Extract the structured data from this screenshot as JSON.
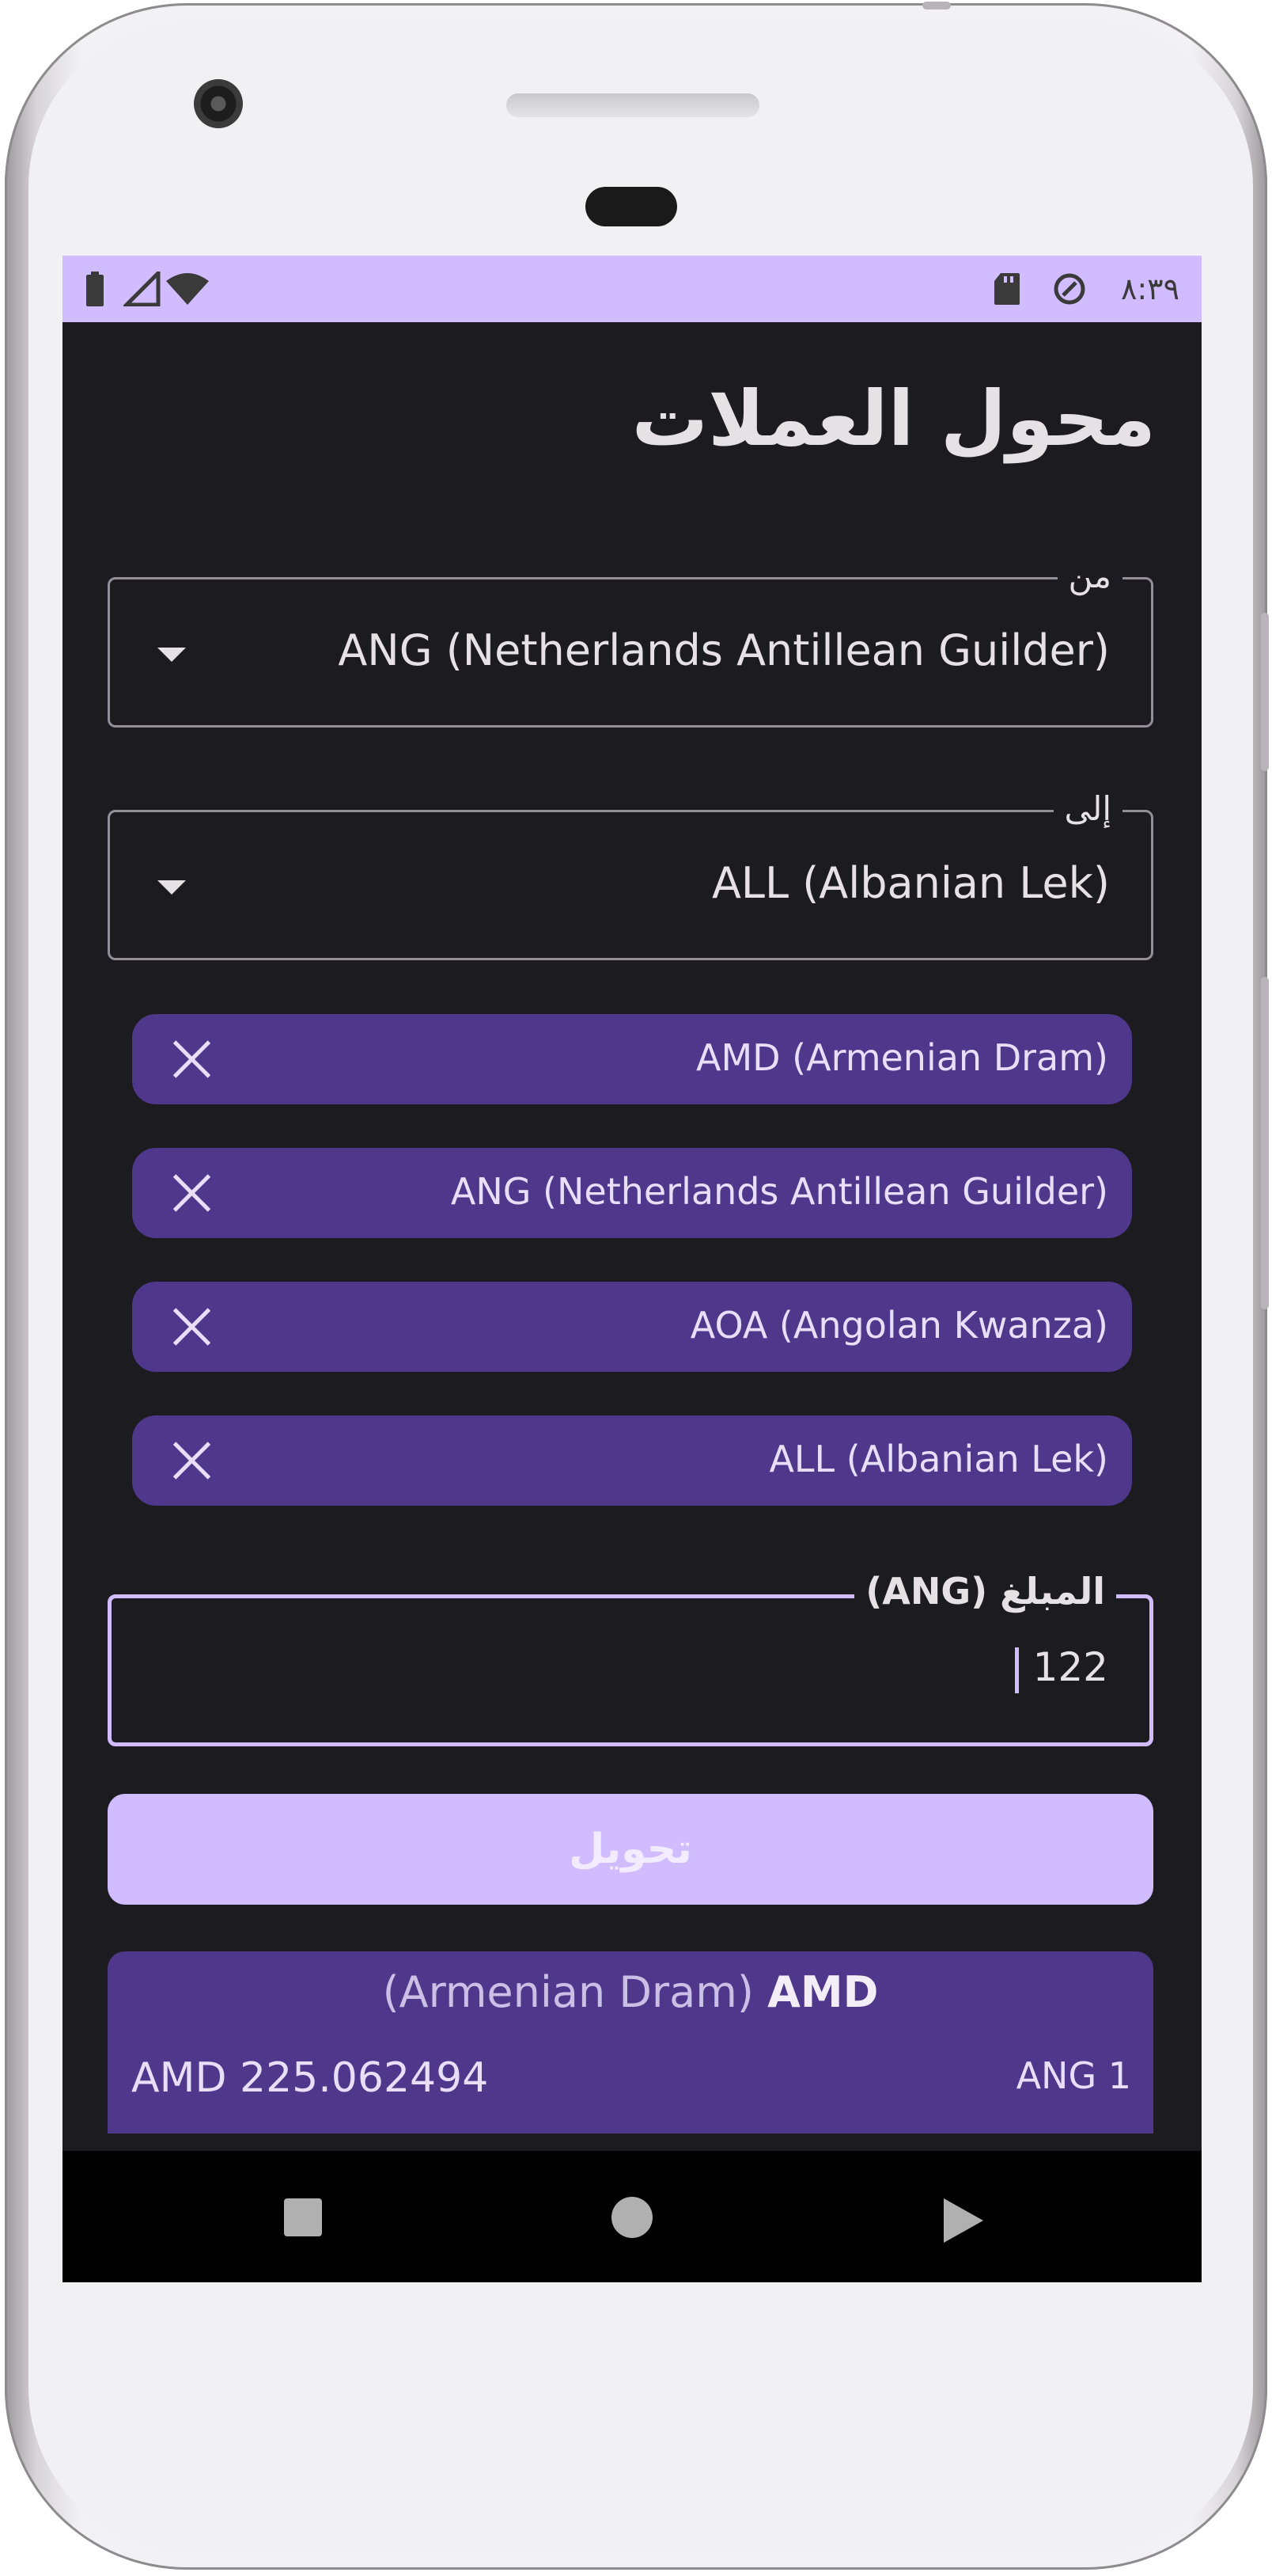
{
  "status_bar": {
    "time": "٨:٣٩",
    "left_icons": [
      "battery-icon",
      "signal-icon",
      "wifi-icon"
    ],
    "right_icons": [
      "sd-card-icon",
      "data-saver-icon"
    ]
  },
  "app": {
    "title": "محول العملات"
  },
  "from_field": {
    "label": "من",
    "value": "ANG (Netherlands Antillean Guilder)"
  },
  "to_field": {
    "label": "إلى",
    "value": "ALL (Albanian Lek)"
  },
  "chips": [
    {
      "label": "AMD (Armenian Dram)"
    },
    {
      "label": "ANG (Netherlands Antillean Guilder)"
    },
    {
      "label": "AOA (Angolan Kwanza)"
    },
    {
      "label": "ALL (Albanian Lek)"
    }
  ],
  "amount_field": {
    "label": "المبلغ (ANG)",
    "value": "122"
  },
  "convert_button": {
    "label": "تحويل"
  },
  "result_card": {
    "code": "AMD",
    "name": "(Armenian Dram)",
    "result": "AMD 225.062494",
    "source": "ANG 1"
  },
  "colors": {
    "primary": "#d0bcff",
    "chip_bg": "#4f378b",
    "background": "#1c1b1f",
    "on_surface": "#e6e1e5"
  }
}
